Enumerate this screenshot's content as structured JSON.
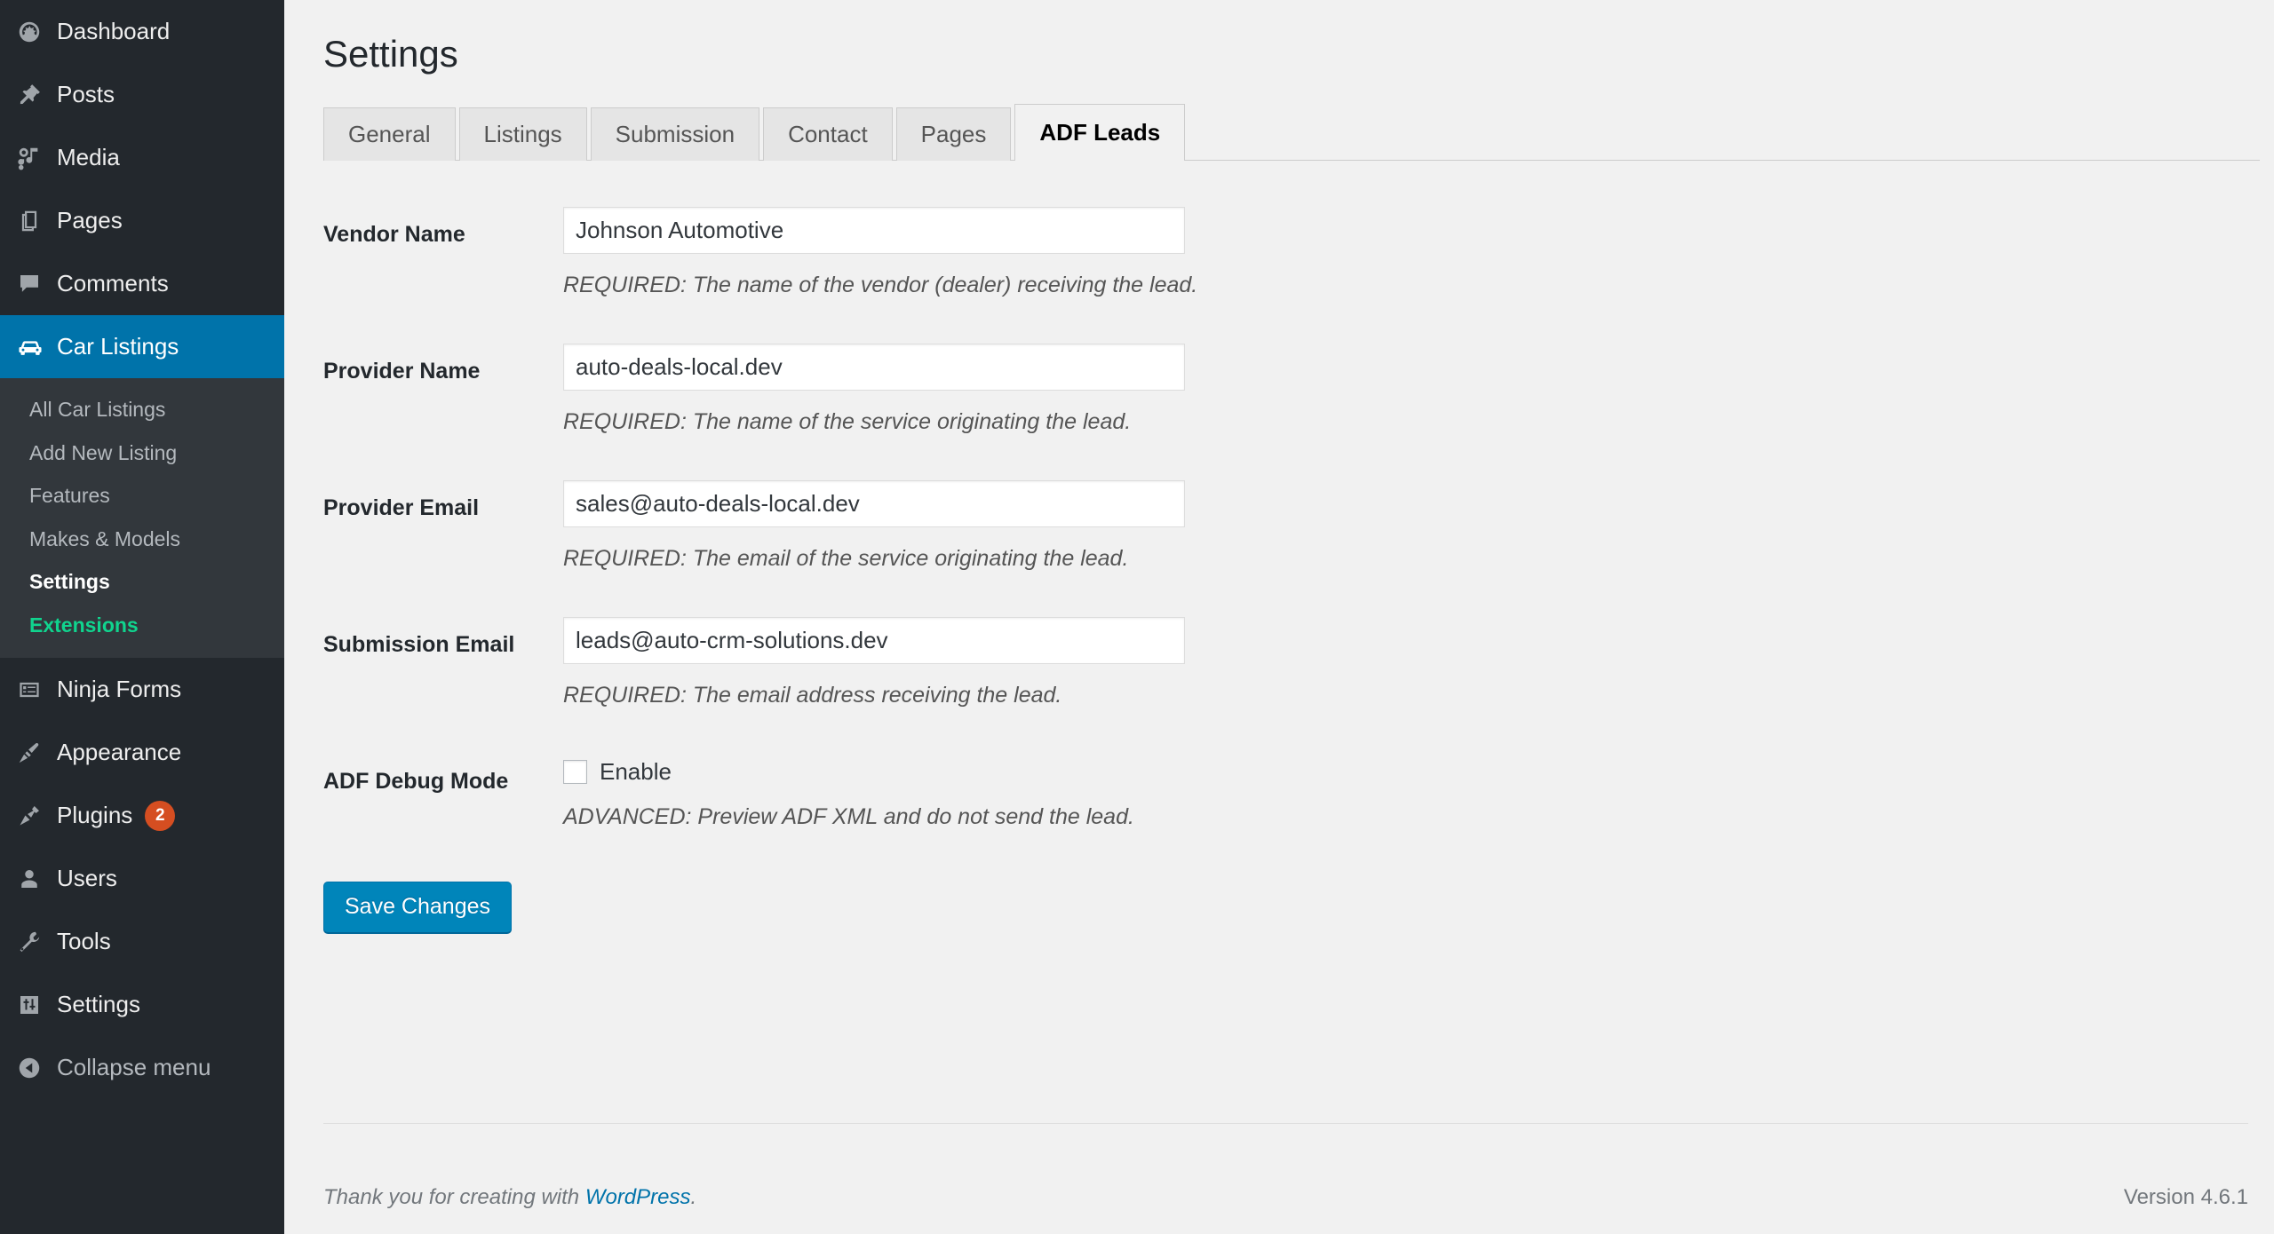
{
  "sidebar": {
    "items": [
      {
        "label": "Dashboard",
        "icon": "dashboard-icon",
        "current": false
      },
      {
        "label": "Posts",
        "icon": "pin-icon",
        "current": false
      },
      {
        "label": "Media",
        "icon": "media-icon",
        "current": false
      },
      {
        "label": "Pages",
        "icon": "pages-icon",
        "current": false
      },
      {
        "label": "Comments",
        "icon": "comment-icon",
        "current": false
      },
      {
        "label": "Car Listings",
        "icon": "car-icon",
        "current": true
      },
      {
        "label": "Ninja Forms",
        "icon": "form-icon",
        "current": false
      },
      {
        "label": "Appearance",
        "icon": "brush-icon",
        "current": false
      },
      {
        "label": "Plugins",
        "icon": "plug-icon",
        "current": false,
        "badge": "2"
      },
      {
        "label": "Users",
        "icon": "user-icon",
        "current": false
      },
      {
        "label": "Tools",
        "icon": "wrench-icon",
        "current": false
      },
      {
        "label": "Settings",
        "icon": "sliders-icon",
        "current": false
      },
      {
        "label": "Collapse menu",
        "icon": "collapse-icon",
        "current": false
      }
    ],
    "submenu": [
      {
        "label": "All Car Listings",
        "state": "normal"
      },
      {
        "label": "Add New Listing",
        "state": "normal"
      },
      {
        "label": "Features",
        "state": "normal"
      },
      {
        "label": "Makes & Models",
        "state": "normal"
      },
      {
        "label": "Settings",
        "state": "active"
      },
      {
        "label": "Extensions",
        "state": "highlight"
      }
    ],
    "badge_color": "#d54e21",
    "current_color": "#0073aa",
    "highlight_color": "#10d48e"
  },
  "header": {
    "title": "Settings"
  },
  "tabs": [
    {
      "label": "General",
      "active": false
    },
    {
      "label": "Listings",
      "active": false
    },
    {
      "label": "Submission",
      "active": false
    },
    {
      "label": "Contact",
      "active": false
    },
    {
      "label": "Pages",
      "active": false
    },
    {
      "label": "ADF Leads",
      "active": true
    }
  ],
  "form": {
    "fields": [
      {
        "label": "Vendor Name",
        "type": "text",
        "value": "Johnson Automotive",
        "placeholder": "",
        "description": "REQUIRED: The name of the vendor (dealer) receiving the lead."
      },
      {
        "label": "Provider Name",
        "type": "text",
        "value": "auto-deals-local.dev",
        "placeholder": "",
        "description": "REQUIRED: The name of the service originating the lead."
      },
      {
        "label": "Provider Email",
        "type": "text",
        "value": "sales@auto-deals-local.dev",
        "placeholder": "",
        "description": "REQUIRED: The email of the service originating the lead."
      },
      {
        "label": "Submission Email",
        "type": "text",
        "value": "leads@auto-crm-solutions.dev",
        "placeholder": "",
        "description": "REQUIRED: The email address receiving the lead."
      },
      {
        "label": "ADF Debug Mode",
        "type": "checkbox",
        "checkbox_label": "Enable",
        "checked": false,
        "description": "ADVANCED: Preview ADF XML and do not send the lead."
      }
    ],
    "save_label": "Save Changes",
    "save_color": "#0085ba"
  },
  "footer": {
    "thanks_prefix": "Thank you for creating with ",
    "link_label": "WordPress",
    "thanks_suffix": ".",
    "version": "Version 4.6.1",
    "link_color": "#0073aa"
  }
}
